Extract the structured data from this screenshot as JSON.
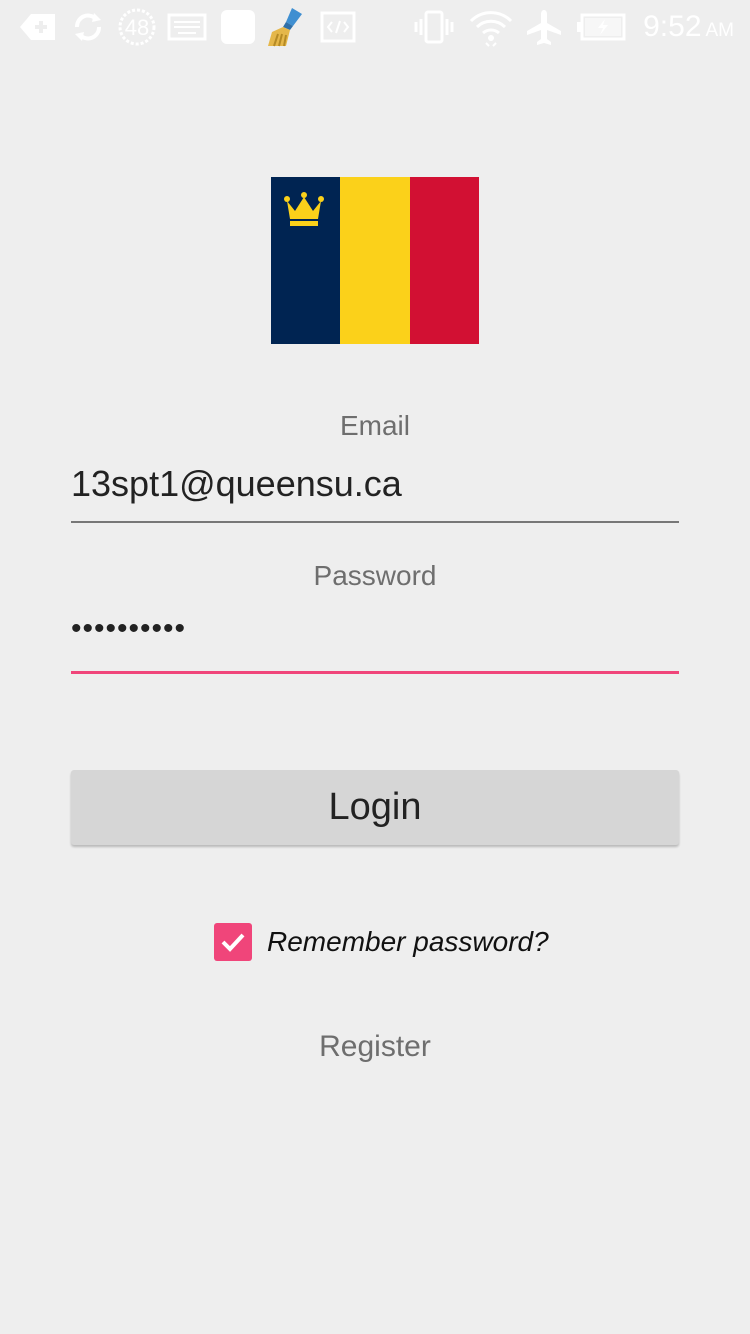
{
  "status_bar": {
    "icons": [
      "back-plus-icon",
      "sync-icon",
      "notification-count-icon",
      "keyboard-icon",
      "square-app-icon",
      "broom-cleaner-icon",
      "code-icon",
      "vibrate-icon",
      "wifi-icon",
      "airplane-icon",
      "battery-icon"
    ],
    "notification_count": "48",
    "time": "9:52",
    "ampm": "AM"
  },
  "logo": {
    "colors": [
      "#002452",
      "#fbd11a",
      "#d21033"
    ],
    "crown_color": "#fbd11a"
  },
  "form": {
    "email_label": "Email",
    "email_value": "13spt1@queensu.ca",
    "password_label": "Password",
    "password_value": "••••••••••",
    "login_label": "Login",
    "remember_label": "Remember password?",
    "remember_checked": true,
    "register_label": "Register"
  },
  "colors": {
    "background": "#eeeeee",
    "accent": "#f0457a",
    "button": "#d6d6d6"
  }
}
